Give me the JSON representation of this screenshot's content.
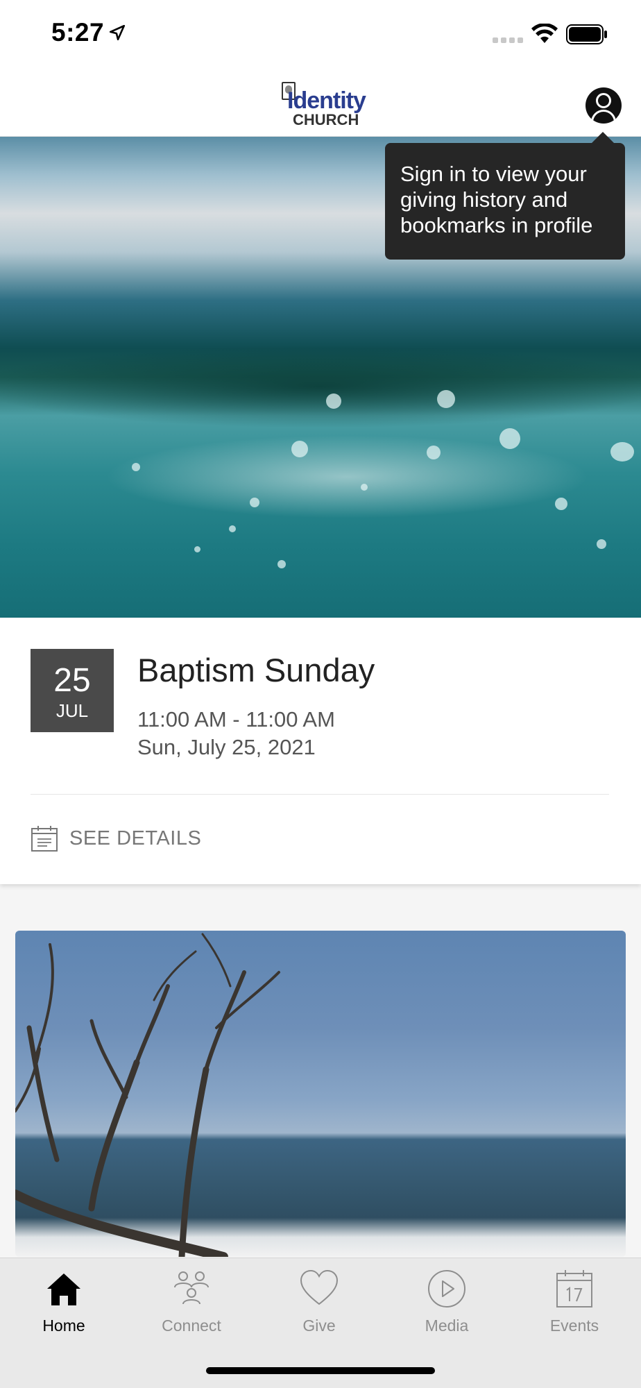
{
  "status_bar": {
    "time": "5:27",
    "icons": [
      "location-arrow-icon",
      "signal-icon",
      "wifi-icon",
      "battery-icon"
    ]
  },
  "header": {
    "logo": {
      "line1": "Identity",
      "line2": "CHURCH"
    },
    "profile_icon": "person-circle-icon"
  },
  "tooltip": {
    "text": "Sign in to view your giving history and bookmarks in profile"
  },
  "event": {
    "day": "25",
    "month": "JUL",
    "title": "Baptism Sunday",
    "time_range": "11:00 AM - 11:00 AM",
    "date": "Sun, July 25, 2021",
    "details_label": "SEE DETAILS"
  },
  "tabs": [
    {
      "label": "Home",
      "icon": "home-icon",
      "active": true
    },
    {
      "label": "Connect",
      "icon": "people-icon",
      "active": false
    },
    {
      "label": "Give",
      "icon": "heart-icon",
      "active": false
    },
    {
      "label": "Media",
      "icon": "play-icon",
      "active": false
    },
    {
      "label": "Events",
      "icon": "calendar-icon",
      "active": false
    }
  ],
  "colors": {
    "tooltip_bg": "#262626",
    "date_badge_bg": "#4a4a4a",
    "tab_bar_bg": "#e9e9e9",
    "logo_blue": "#2a3d8f"
  }
}
